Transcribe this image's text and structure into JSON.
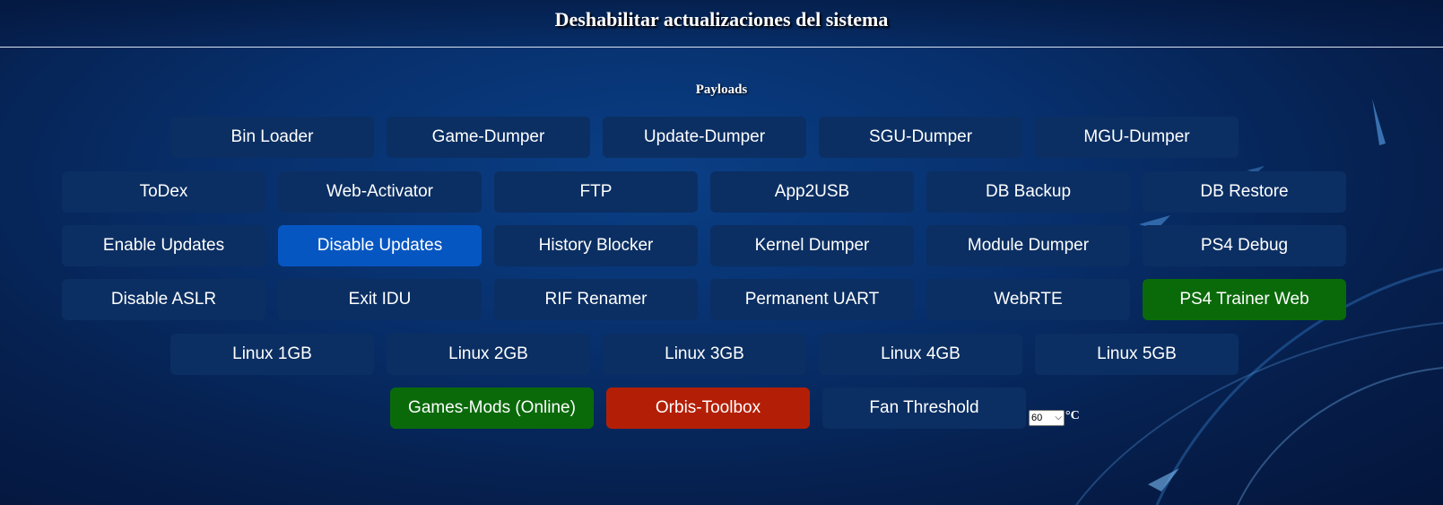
{
  "header": {
    "title": "Deshabilitar actualizaciones del sistema"
  },
  "section": {
    "title": "Payloads"
  },
  "rows": [
    [
      "Bin Loader",
      "Game-Dumper",
      "Update-Dumper",
      "SGU-Dumper",
      "MGU-Dumper"
    ],
    [
      "ToDex",
      "Web-Activator",
      "FTP",
      "App2USB",
      "DB Backup",
      "DB Restore"
    ],
    [
      "Enable Updates",
      "Disable Updates",
      "History Blocker",
      "Kernel Dumper",
      "Module Dumper",
      "PS4 Debug"
    ],
    [
      "Disable ASLR",
      "Exit IDU",
      "RIF Renamer",
      "Permanent UART",
      "WebRTE",
      "PS4 Trainer Web"
    ],
    [
      "Linux 1GB",
      "Linux 2GB",
      "Linux 3GB",
      "Linux 4GB",
      "Linux 5GB"
    ],
    [
      "Games-Mods (Online)",
      "Orbis-Toolbox",
      "Fan Threshold"
    ]
  ],
  "button_states": {
    "Disable Updates": "active",
    "PS4 Trainer Web": "green",
    "Games-Mods (Online)": "green",
    "Orbis-Toolbox": "red"
  },
  "fan": {
    "selected": "60",
    "unit": "°C"
  },
  "colors": {
    "button_default": "#0b2f63",
    "button_active": "#0656c2",
    "button_green": "#0a6a0a",
    "button_red": "#b31f06"
  }
}
